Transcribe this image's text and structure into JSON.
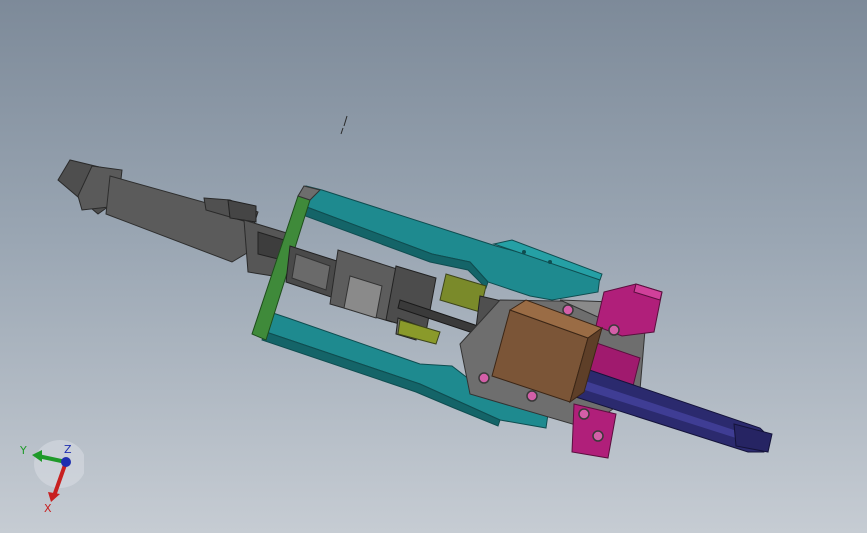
{
  "viewport": {
    "background_top": "#7d8a99",
    "background_bottom": "#c6ccd3"
  },
  "triad": {
    "labels": {
      "x": "X",
      "y": "Y",
      "z": "Z"
    },
    "colors": {
      "x": "#c82020",
      "y": "#1f9a2a",
      "z": "#1f2fb0"
    }
  },
  "parts": {
    "colors": {
      "cylinder": "#5b5b5b",
      "frame": "#1e8a8f",
      "frame_dark": "#146468",
      "end_plate": "#3f8a3a",
      "slide_block": "#7b5537",
      "mount_block": "#b01f7a",
      "rod": "#2b2a6e",
      "guide_green": "#7a8a2a",
      "base_plate": "#6e6e6e",
      "bolt": "#d35fa8"
    }
  }
}
